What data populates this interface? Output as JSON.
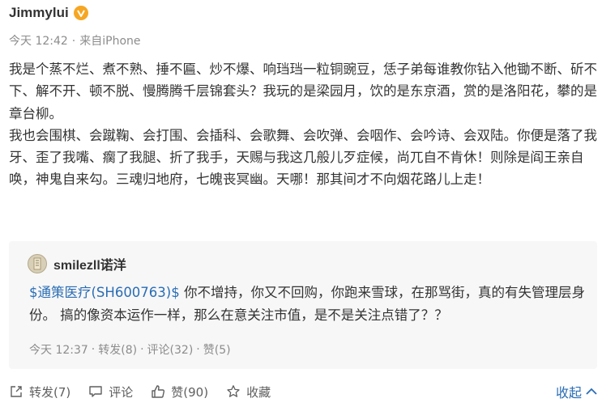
{
  "author": {
    "name": "Jimmylui",
    "badge_icon": "verified-v-badge-icon",
    "badge_color": "#f6a623"
  },
  "meta": {
    "time": "今天 12:42",
    "separator": "·",
    "source": "来自iPhone"
  },
  "body": {
    "paragraph1": "我是个蒸不烂、煮不熟、捶不匾、炒不爆、响珰珰一粒铜豌豆，恁子弟每谁教你钻入他锄不断、斫不下、解不开、顿不脱、慢腾腾千层锦套头？我玩的是梁园月，饮的是东京酒，赏的是洛阳花，攀的是章台柳。",
    "paragraph2": "我也会围棋、会蹴鞠、会打围、会插科、会歌舞、会吹弹、会咽作、会吟诗、会双陆。你便是落了我牙、歪了我嘴、瘸了我腿、折了我手，天赐与我这几般儿歹症候，尚兀自不肯休！则除是阎王亲自唤，神鬼自来勾。三魂归地府，七魄丧冥幽。天哪！那其间才不向烟花路儿上走！"
  },
  "quoted": {
    "author": "smilezll诺洋",
    "avatar_icon": "avatar-icon",
    "stock_tag": "$通策医疗(SH600763)$",
    "text": " 你不增持，你又不回购，你跑来雪球，在那骂街，真的有失管理层身份。 搞的像资本运作一样，那么在意关注市值，是不是关注点错了？？",
    "time": "今天 12:37",
    "separator": "·",
    "repost": "转发(8)",
    "comment": "评论(32)",
    "like": "赞(5)",
    "link_color": "#2a6db5"
  },
  "actions": {
    "repost": "转发(7)",
    "comment": "评论",
    "like": "赞(90)",
    "favorite": "收藏",
    "collapse": "收起"
  }
}
